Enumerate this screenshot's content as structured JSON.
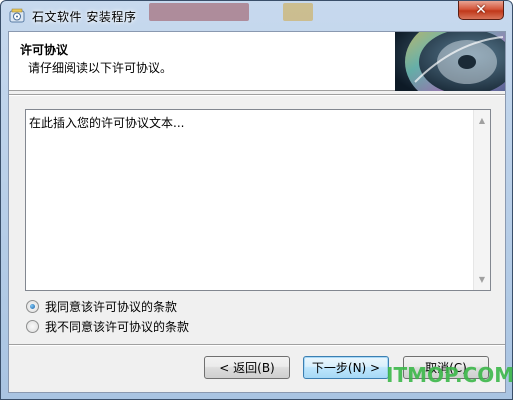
{
  "window": {
    "title": "石文软件 安装程序",
    "close_glyph": "✕",
    "title_icon": "installer-icon"
  },
  "header": {
    "title": "许可协议",
    "subtitle": "请仔细阅读以下许可协议。",
    "image": "cd-disc-image"
  },
  "license": {
    "text": "在此插入您的许可协议文本..."
  },
  "options": [
    {
      "label": "我同意该许可协议的条款",
      "checked": true
    },
    {
      "label": "我不同意该许可协议的条款",
      "checked": false
    }
  ],
  "buttons": {
    "back": "< 返回(B)",
    "next": "下一步(N) >",
    "cancel": "取消(C)"
  },
  "watermark": "ITMOP.COM",
  "colors": {
    "watermark": "#3cb84a",
    "close_button": "#c7422a"
  }
}
